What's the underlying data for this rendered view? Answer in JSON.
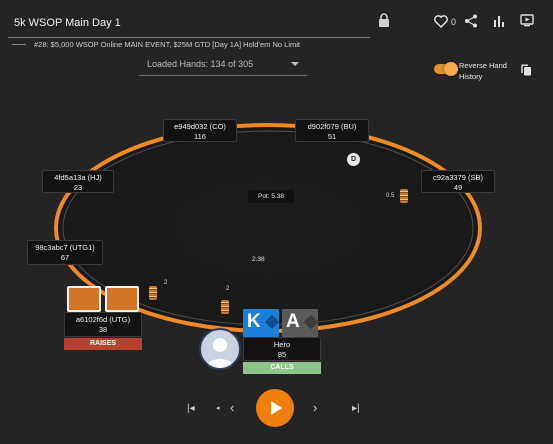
{
  "header": {
    "title": "5k WSOP Main Day 1",
    "like_count": "0",
    "subtitle": "#28: $5,000 WSOP Online MAIN EVENT, $25M GTD [Day 1A] Hold'em No Limit",
    "hands_loaded": "Loaded Hands: 134 of 305",
    "reverse_label_line1": "Reverse Hand",
    "reverse_label_line2": "History",
    "reverse_toggle_on": true
  },
  "table": {
    "pot_label": "Pot: 5.38",
    "center_amount": "2.38",
    "dealer_symbol": "D",
    "felt_color": "#1a1a1a",
    "rail_color": "#f08a24"
  },
  "seats": [
    {
      "name": "e949d032 (CO)",
      "stack": "116"
    },
    {
      "name": "d902f079 (BU)",
      "stack": "51"
    },
    {
      "name": "4fd5a13a (HJ)",
      "stack": "23"
    },
    {
      "name": "c92a3379 (SB)",
      "stack": "49"
    },
    {
      "name": "98c3abc7 (UTG1)",
      "stack": "67"
    },
    {
      "name": "a6102f6d (UTG)",
      "stack": "38",
      "action": "RAISES",
      "action_color": "#b7412f"
    },
    {
      "name": "Hero",
      "stack": "85",
      "action": "CALLS",
      "action_color": "#8dc48a"
    }
  ],
  "bets": {
    "sb": "0.5",
    "utg": "2",
    "hero": "2"
  },
  "hero_cards": [
    {
      "rank": "K",
      "suit": "diamonds",
      "color": "#1a7fd6"
    },
    {
      "rank": "A",
      "suit": "spades",
      "color": "#5a5a5a"
    }
  ],
  "controls": {
    "first": "|◂",
    "prev_street": "◂",
    "prev": "‹",
    "next": "›",
    "last": "▸|"
  },
  "colors": {
    "accent": "#f07f10",
    "background": "#242424"
  }
}
